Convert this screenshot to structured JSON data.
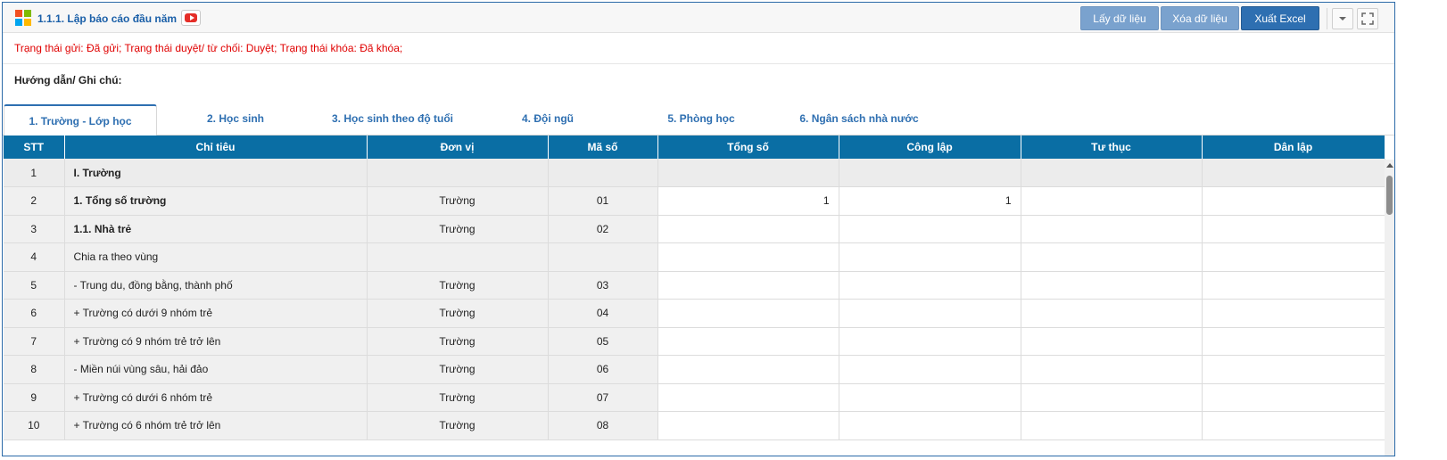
{
  "header": {
    "title": "1.1.1. Lập báo cáo đầu năm",
    "buttons": {
      "get_data": "Lấy dữ liệu",
      "delete_data": "Xóa dữ liệu",
      "export_excel": "Xuất Excel"
    }
  },
  "status_text": "Trạng thái gửi: Đã gửi; Trạng thái duyệt/ từ chối: Duyệt; Trạng thái khóa: Đã khóa;",
  "guide_label": "Hướng dẫn/ Ghi chú:",
  "tabs": [
    {
      "label": "1. Trường - Lớp học",
      "active": true
    },
    {
      "label": "2. Học sinh"
    },
    {
      "label": "3. Học sinh theo độ tuổi"
    },
    {
      "label": "4. Đội ngũ"
    },
    {
      "label": "5. Phòng học"
    },
    {
      "label": "6. Ngân sách nhà nước"
    }
  ],
  "table": {
    "columns": [
      "STT",
      "Chỉ tiêu",
      "Đơn vị",
      "Mã số",
      "Tổng số",
      "Công lập",
      "Tư thục",
      "Dân lập"
    ],
    "rows": [
      {
        "stt": "1",
        "chi_tieu": "I. Trường",
        "don_vi": "",
        "ma_so": "",
        "tong_so": "",
        "cong_lap": "",
        "tu_thuc": "",
        "dan_lap": ""
      },
      {
        "stt": "2",
        "chi_tieu": "1. Tổng số trường",
        "don_vi": "Trường",
        "ma_so": "01",
        "tong_so": "1",
        "cong_lap": "1",
        "tu_thuc": "",
        "dan_lap": ""
      },
      {
        "stt": "3",
        "chi_tieu": "1.1. Nhà trẻ",
        "don_vi": "Trường",
        "ma_so": "02",
        "tong_so": "",
        "cong_lap": "",
        "tu_thuc": "",
        "dan_lap": ""
      },
      {
        "stt": "4",
        "chi_tieu": "Chia ra theo vùng",
        "don_vi": "",
        "ma_so": "",
        "tong_so": "",
        "cong_lap": "",
        "tu_thuc": "",
        "dan_lap": ""
      },
      {
        "stt": "5",
        "chi_tieu": "- Trung du, đồng bằng, thành phố",
        "don_vi": "Trường",
        "ma_so": "03",
        "tong_so": "",
        "cong_lap": "",
        "tu_thuc": "",
        "dan_lap": ""
      },
      {
        "stt": "6",
        "chi_tieu": "+ Trường có dưới 9 nhóm trẻ",
        "don_vi": "Trường",
        "ma_so": "04",
        "tong_so": "",
        "cong_lap": "",
        "tu_thuc": "",
        "dan_lap": ""
      },
      {
        "stt": "7",
        "chi_tieu": "+ Trường có 9 nhóm trẻ trở lên",
        "don_vi": "Trường",
        "ma_so": "05",
        "tong_so": "",
        "cong_lap": "",
        "tu_thuc": "",
        "dan_lap": ""
      },
      {
        "stt": "8",
        "chi_tieu": "- Miền núi vùng sâu, hải đảo",
        "don_vi": "Trường",
        "ma_so": "06",
        "tong_so": "",
        "cong_lap": "",
        "tu_thuc": "",
        "dan_lap": ""
      },
      {
        "stt": "9",
        "chi_tieu": "+ Trường có dưới 6 nhóm trẻ",
        "don_vi": "Trường",
        "ma_so": "07",
        "tong_so": "",
        "cong_lap": "",
        "tu_thuc": "",
        "dan_lap": ""
      },
      {
        "stt": "10",
        "chi_tieu": "+ Trường có 6 nhóm trẻ trở lên",
        "don_vi": "Trường",
        "ma_so": "08",
        "tong_so": "",
        "cong_lap": "",
        "tu_thuc": "",
        "dan_lap": ""
      }
    ]
  },
  "icons": {
    "logo": "windows-grid-icon",
    "video": "youtube-play-icon",
    "collapse": "chevron-down-icon",
    "fullscreen": "fullscreen-icon"
  },
  "colors": {
    "header_blue": "#0a6ea4",
    "status_red": "#e00000",
    "title_blue": "#1a5fa8",
    "button_light": "#7aa2ce",
    "button_dark": "#2e6fb1"
  }
}
